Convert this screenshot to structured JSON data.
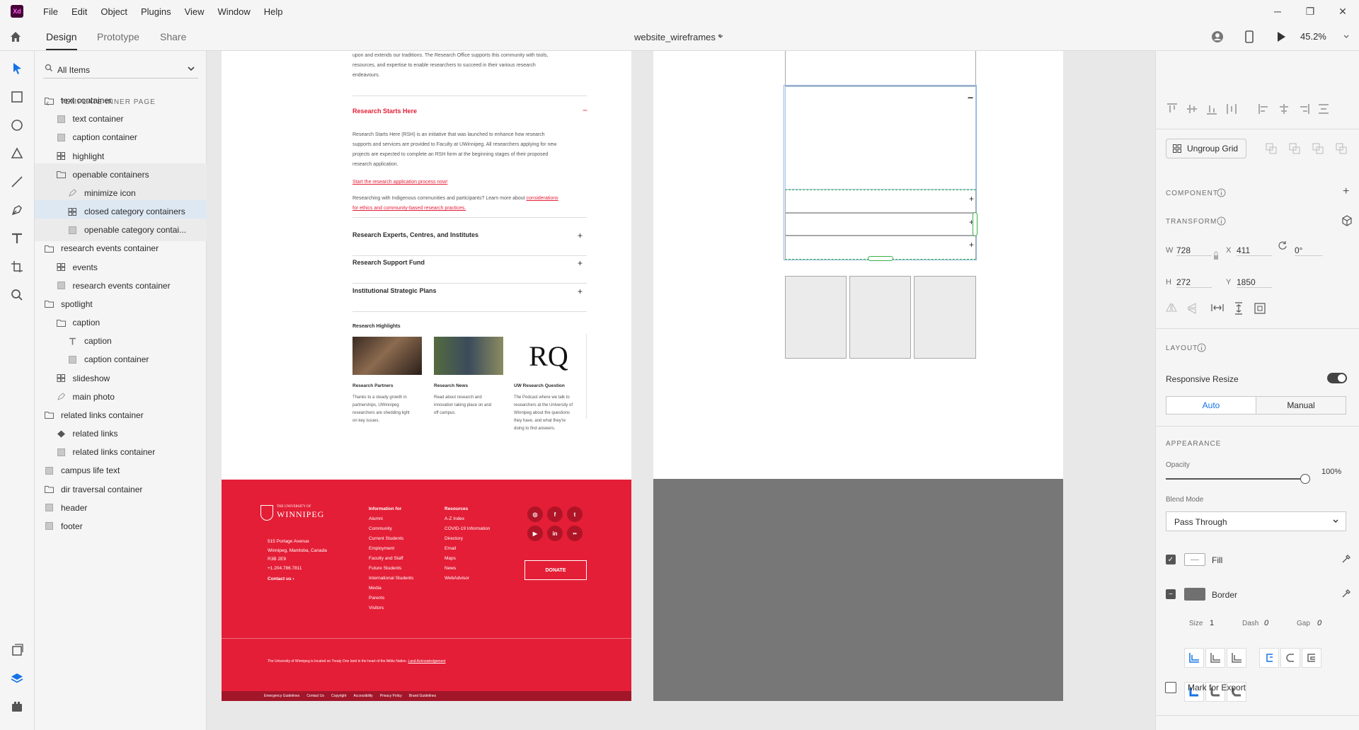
{
  "menubar": {
    "app_logo": "Xd",
    "items": [
      "File",
      "Edit",
      "Object",
      "Plugins",
      "View",
      "Window",
      "Help"
    ]
  },
  "toolbar": {
    "tabs": [
      "Design",
      "Prototype",
      "Share"
    ],
    "document_title": "website_wireframes *",
    "zoom": "45.2%"
  },
  "layers": {
    "search_placeholder": "All Items",
    "breadcrumb": "TEMPLATE INNER PAGE",
    "items": [
      {
        "label": "text container",
        "type": "folder",
        "indent": 0
      },
      {
        "label": "text container",
        "type": "rect",
        "indent": 1
      },
      {
        "label": "caption container",
        "type": "rect",
        "indent": 1
      },
      {
        "label": "highlight",
        "type": "grid",
        "indent": 1
      },
      {
        "label": "openable containers",
        "type": "folder",
        "indent": 1
      },
      {
        "label": "minimize icon",
        "type": "pen",
        "indent": 2
      },
      {
        "label": "closed category containers",
        "type": "grid",
        "indent": 2
      },
      {
        "label": "openable category contai...",
        "type": "rect",
        "indent": 2
      },
      {
        "label": "research events container",
        "type": "folder",
        "indent": 0
      },
      {
        "label": "events",
        "type": "grid",
        "indent": 1
      },
      {
        "label": "research events container",
        "type": "rect",
        "indent": 1
      },
      {
        "label": "spotlight",
        "type": "folder",
        "indent": 0
      },
      {
        "label": "caption",
        "type": "folder",
        "indent": 1
      },
      {
        "label": "caption",
        "type": "text",
        "indent": 2
      },
      {
        "label": "caption container",
        "type": "rect",
        "indent": 2
      },
      {
        "label": "slideshow",
        "type": "grid",
        "indent": 1
      },
      {
        "label": "main photo",
        "type": "pen",
        "indent": 1
      },
      {
        "label": "related links container",
        "type": "folder",
        "indent": 0
      },
      {
        "label": "related links",
        "type": "component",
        "indent": 1
      },
      {
        "label": "related links container",
        "type": "rect",
        "indent": 1
      },
      {
        "label": "campus life text",
        "type": "rect",
        "indent": 0
      },
      {
        "label": "dir traversal container",
        "type": "folder",
        "indent": 0
      },
      {
        "label": "header",
        "type": "rect",
        "indent": 0
      },
      {
        "label": "footer",
        "type": "rect",
        "indent": 0
      }
    ]
  },
  "artboard_page": {
    "intro_text": [
      "upon and extends our traditions. The Research Office supports this community with tools,",
      "resources, and expertise to enable researchers to succeed in their various research",
      "endeavours."
    ],
    "open_heading": "Research Starts Here",
    "open_body": [
      "Research Starts Here (RSH) is an initiative that was launched to enhance how research",
      "supports and services are provided to Faculty at UWinnipeg. All researchers applying for new",
      "projects are expected to complete an RSH form at the beginning stages of their proposed",
      "research application."
    ],
    "open_link": "Start the research application process now!",
    "open_body2_a": "Researching with Indigenous communities and participants? Learn more about ",
    "open_body2_link": "considerations",
    "open_body2_b": "for ethics and community-based research practices.",
    "closed_rows": [
      "Research Experts, Centres, and Institutes",
      "Research Support Fund",
      "Institutional Strategic Plans"
    ],
    "highlights_title": "Research Highlights",
    "highlights": [
      {
        "title": "Research Partners",
        "desc": [
          "Thanks to a steady growth in",
          "partnerships, UWinnipeg",
          "researchers are shedding light",
          "on key issues."
        ]
      },
      {
        "title": "Research News",
        "desc": [
          "Read about research and",
          "innovation taking place on and",
          "off campus."
        ]
      },
      {
        "title": "UW Research Question",
        "desc": [
          "The Podcast where we talk to",
          "researchers at the University of",
          "Winnipeg about the questions",
          "they have, and what they're",
          "doing to find answers."
        ]
      }
    ],
    "rq_logo": "RQ",
    "footer": {
      "logo_small": "THE UNIVERSITY OF",
      "logo_big": "WINNIPEG",
      "address": [
        "515 Portage Avenue",
        "Winnipeg, Manitoba, Canada",
        "R3B 2E9",
        "+1.204.786.7811"
      ],
      "contact": "Contact us",
      "info_heading": "Information for",
      "info_items": [
        "Alumni",
        "Community",
        "Current Students",
        "Employment",
        "Faculty and Staff",
        "Future Students",
        "International Students",
        "Media",
        "Parents",
        "Visitors"
      ],
      "res_heading": "Resources",
      "res_items": [
        "A-Z Index",
        "COVID-19 Information",
        "Directory",
        "Email",
        "Maps",
        "News",
        "WebAdvisor"
      ],
      "social": [
        "ig",
        "f",
        "t",
        "yt",
        "in",
        "fl"
      ],
      "donate": "DONATE",
      "land_ack": "The University of Winnipeg is located on Treaty One land in the heart of the Métis Nation. ",
      "land_link": "Land Acknowledgement",
      "bottom_links": [
        "Emergency Guidelines",
        "Contact Us",
        "Copyright",
        "Accessibility",
        "Privacy Policy",
        "Brand Guidelines"
      ]
    }
  },
  "wireframe": {
    "minus": "−",
    "plus": "+"
  },
  "properties": {
    "ungroup_label": "Ungroup Grid",
    "component_title": "COMPONENT",
    "transform_title": "TRANSFORM",
    "w_label": "W",
    "w_value": "728",
    "x_label": "X",
    "x_value": "411",
    "rotation_value": "0°",
    "h_label": "H",
    "h_value": "272",
    "y_label": "Y",
    "y_value": "1850",
    "layout_title": "LAYOUT",
    "responsive_label": "Responsive Resize",
    "responsive_on": true,
    "auto_label": "Auto",
    "manual_label": "Manual",
    "appearance_title": "APPEARANCE",
    "opacity_label": "Opacity",
    "opacity_value": "100%",
    "blend_label": "Blend Mode",
    "blend_value": "Pass Through",
    "fill_label": "Fill",
    "fill_checked": true,
    "border_label": "Border",
    "size_label": "Size",
    "size_value": "1",
    "dash_label": "Dash",
    "dash_value": "0",
    "gap_label": "Gap",
    "gap_value": "0",
    "export_label": "Mark for Export",
    "colors": {
      "accent": "#1473e6",
      "brand_red": "#e41e36",
      "border_swatch": "#707070"
    }
  }
}
